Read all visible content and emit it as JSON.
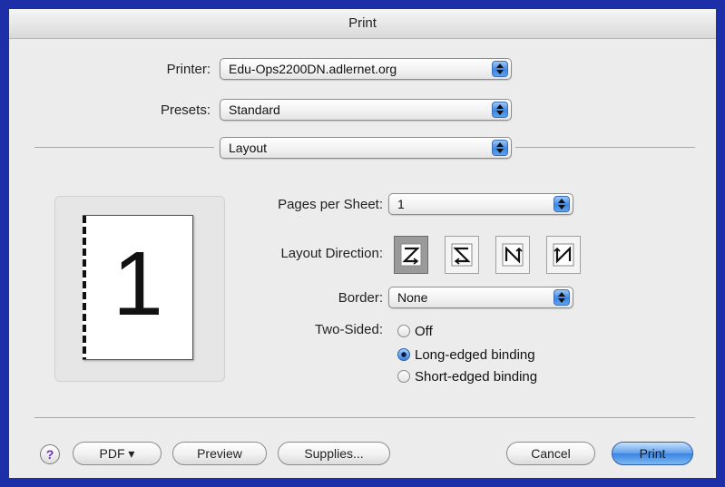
{
  "window": {
    "title": "Print"
  },
  "printer": {
    "label": "Printer:",
    "value": "Edu-Ops2200DN.adlernet.org"
  },
  "presets": {
    "label": "Presets:",
    "value": "Standard"
  },
  "panel": {
    "value": "Layout"
  },
  "preview": {
    "page_number": "1"
  },
  "layout": {
    "pages_per_sheet": {
      "label": "Pages per Sheet:",
      "value": "1"
    },
    "layout_direction": {
      "label": "Layout Direction:",
      "options": [
        "z-order-icon",
        "s-order-icon",
        "reverse-n-order-icon",
        "n-order-icon"
      ],
      "selected_index": 0
    },
    "border": {
      "label": "Border:",
      "value": "None"
    },
    "two_sided": {
      "label": "Two-Sided:",
      "options": [
        "Off",
        "Long-edged binding",
        "Short-edged binding"
      ],
      "selected": "Long-edged binding"
    }
  },
  "buttons": {
    "help": "?",
    "pdf": "PDF ▾",
    "preview": "Preview",
    "supplies": "Supplies...",
    "cancel": "Cancel",
    "print": "Print"
  },
  "colors": {
    "frame": "#1c2ea8",
    "dialog": "#ececec",
    "accent": "#3a84e0",
    "help_icon": "#6b2db5"
  }
}
